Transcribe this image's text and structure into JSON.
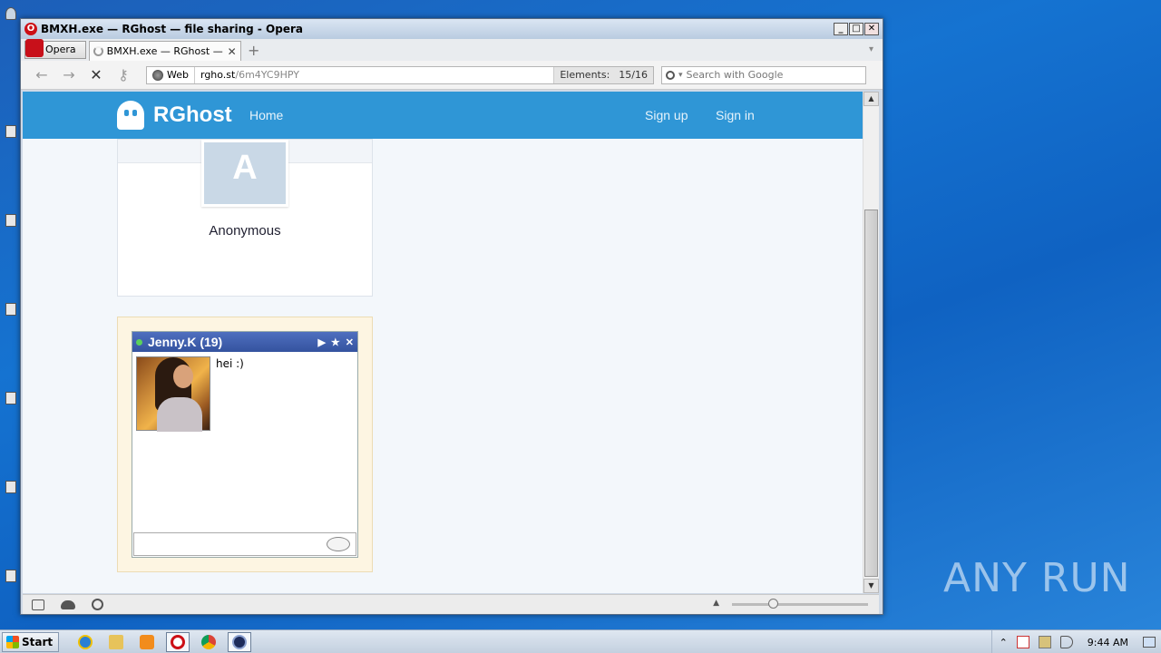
{
  "window": {
    "title": "BMXH.exe — RGhost — file sharing - Opera",
    "controls": {
      "minimize": "_",
      "maximize": "□",
      "close": "✕"
    }
  },
  "browser": {
    "menu_label": "Opera",
    "tab": {
      "label": "BMXH.exe — RGhost — f...",
      "close": "✕"
    },
    "new_tab": "+",
    "tab_menu": "▾",
    "nav": {
      "back": "←",
      "forward": "→",
      "stop": "✕",
      "key": "⚷"
    },
    "address": {
      "scheme_label": "Web",
      "host": "rgho.st",
      "path": "/6m4YC9HPY",
      "elements_label": "Elements:",
      "elements_count": "15/16"
    },
    "search": {
      "placeholder": "Search with Google",
      "caret": "▾"
    },
    "scroll": {
      "up": "▲",
      "down": "▼"
    },
    "zoom_arrow": "▲"
  },
  "site": {
    "logo_text": "RGhost",
    "nav": {
      "home": "Home",
      "signup": "Sign up",
      "signin": "Sign in"
    },
    "user": {
      "avatar_letter": "A",
      "name": "Anonymous"
    }
  },
  "chat": {
    "title": "Jenny.K (19)",
    "icons": {
      "video": "▶",
      "star": "★",
      "close": "✕"
    },
    "message": "hei :)"
  },
  "taskbar": {
    "start_label": "Start",
    "tray_arrow": "⌃",
    "clock": "9:44 AM"
  },
  "watermark": "ANY  RUN",
  "colors": {
    "site_header": "#2f96d6",
    "chat_header": "#34539f",
    "opera_red": "#cc0f16"
  }
}
